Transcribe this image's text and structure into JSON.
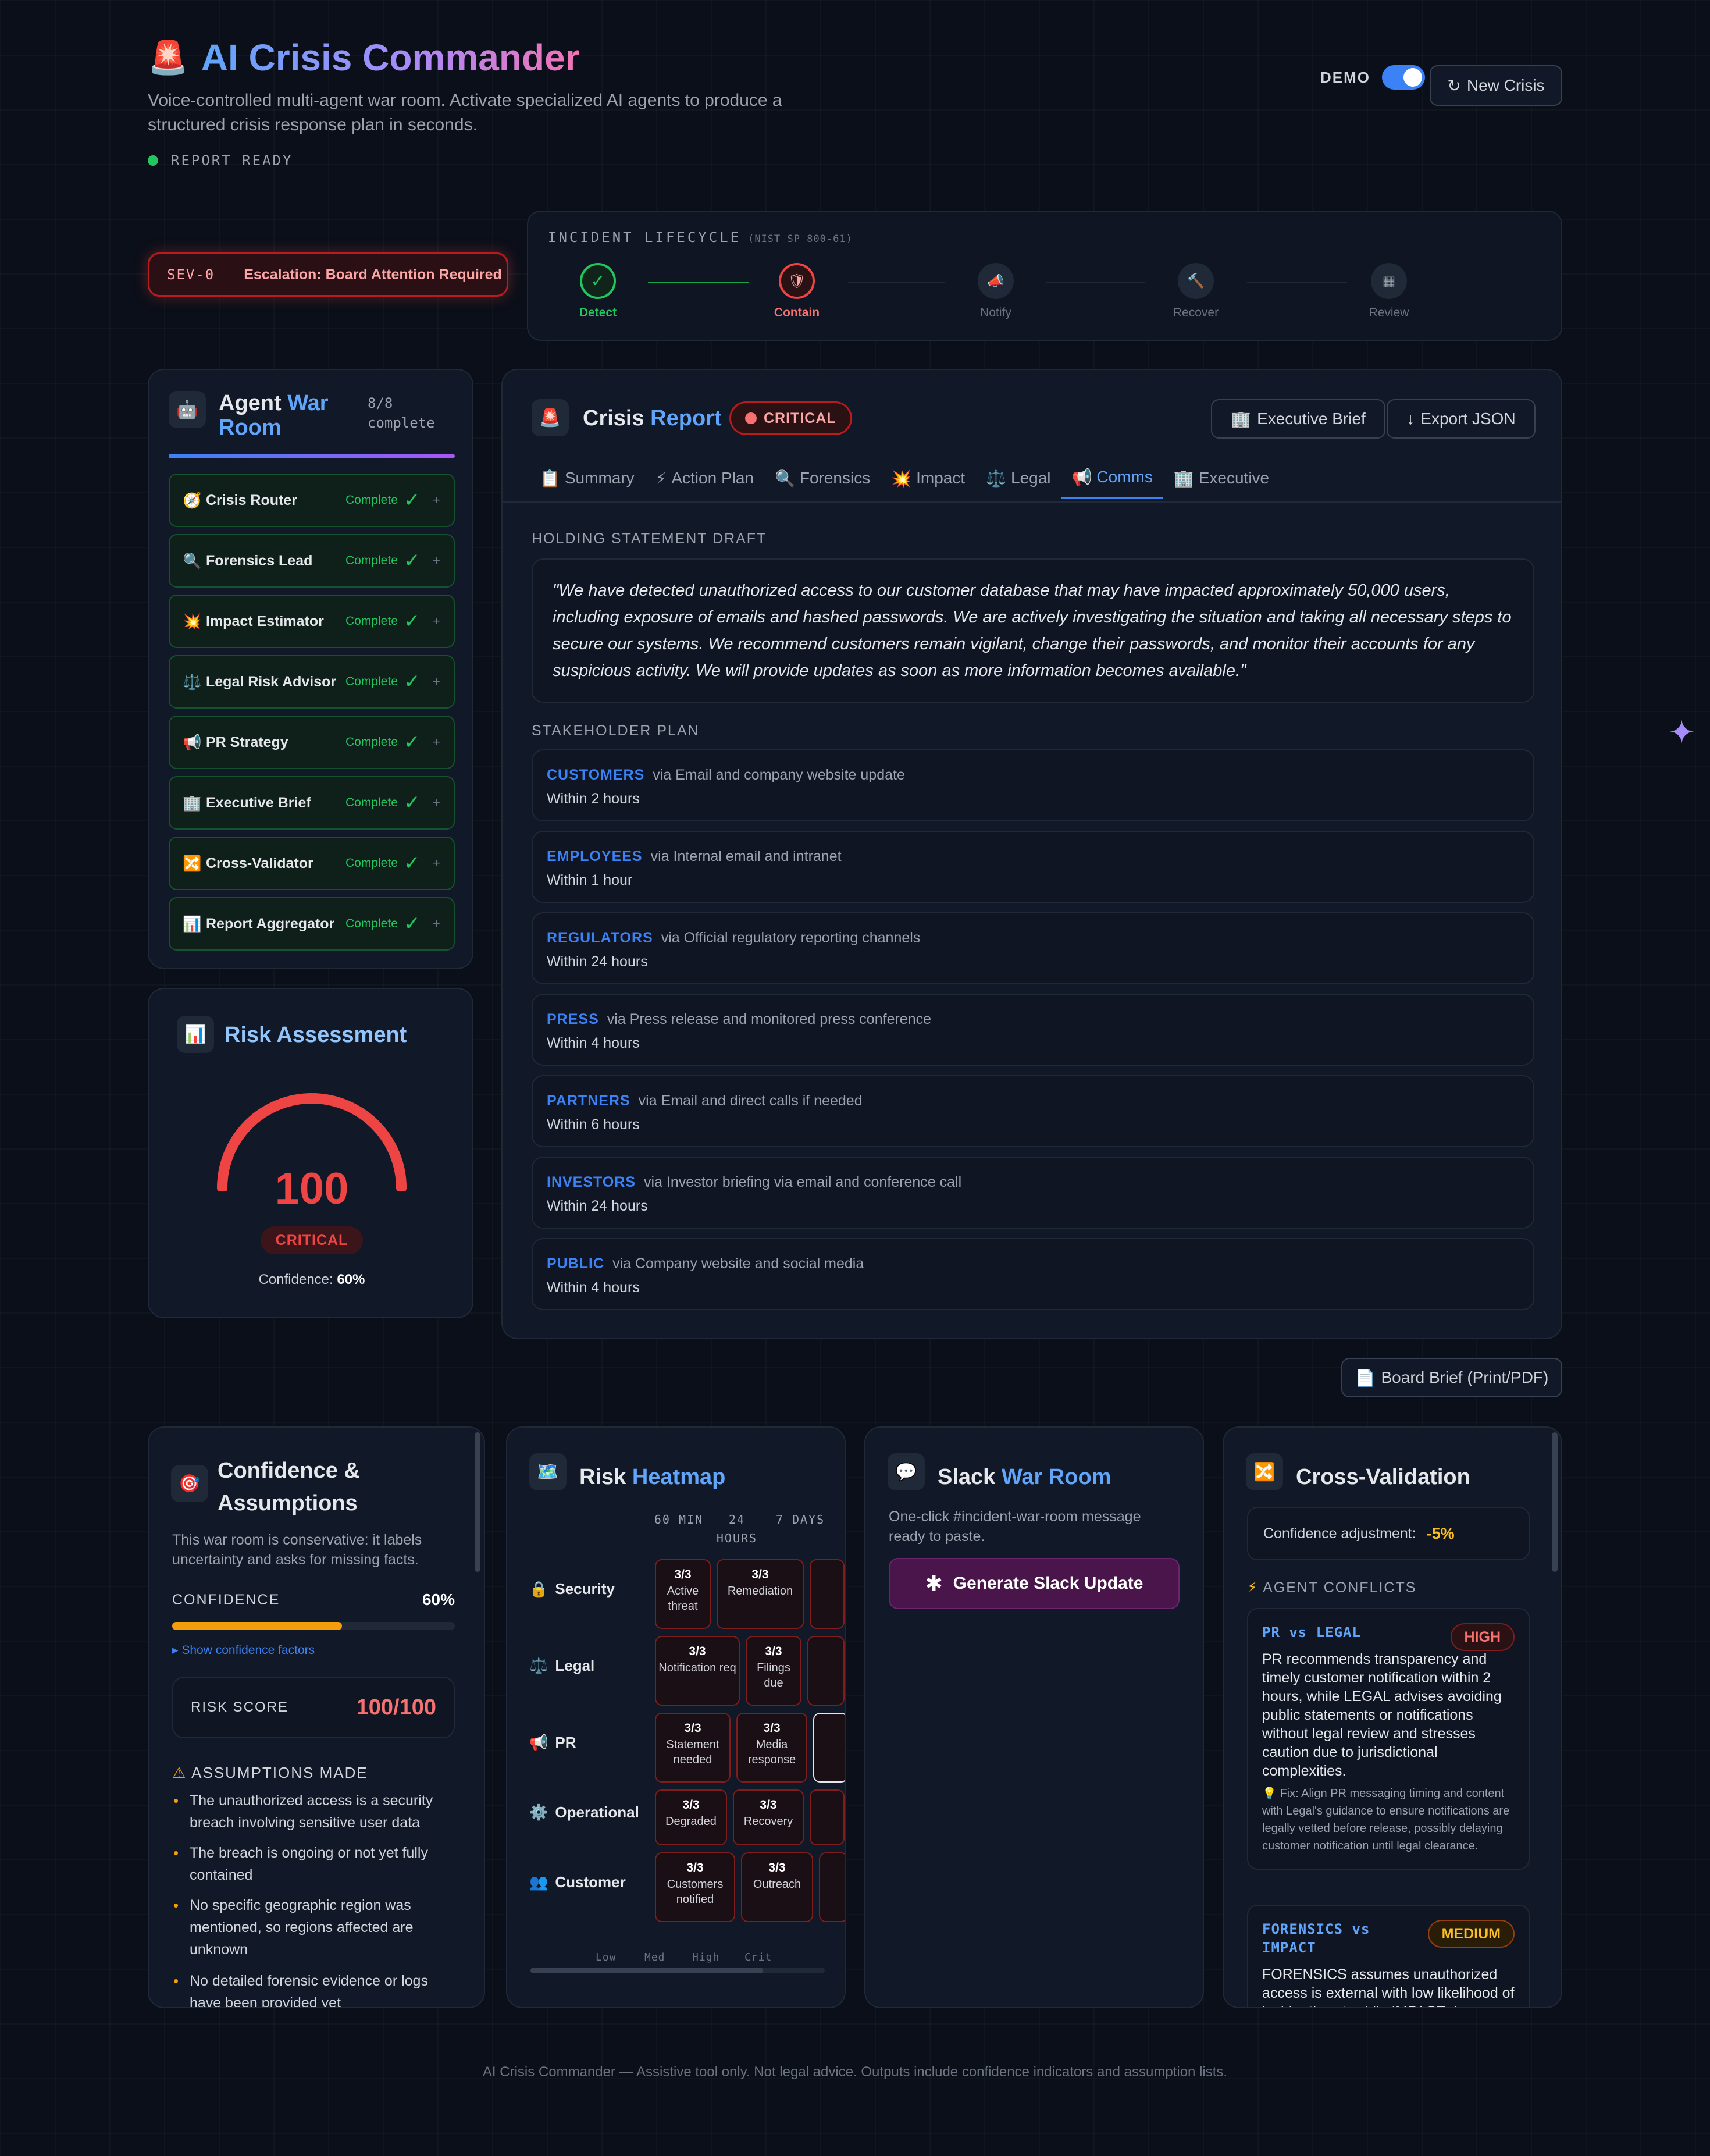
{
  "header": {
    "title": "AI Crisis Commander",
    "subtitle": "Voice-controlled multi-agent war room. Activate specialized AI agents to produce a structured crisis response plan in seconds.",
    "status": "REPORT READY",
    "demo_label": "DEMO",
    "demo_on": true,
    "new_crisis_label": "New Crisis"
  },
  "severity": {
    "code": "SEV-0",
    "message": "Escalation: Board Attention Required"
  },
  "lifecycle": {
    "title": "INCIDENT LIFECYCLE",
    "standard": "(NIST SP 800-61)",
    "stages": [
      {
        "name": "Detect",
        "state": "done",
        "glyph": "✓"
      },
      {
        "name": "Contain",
        "state": "active",
        "glyph": "🛡"
      },
      {
        "name": "Notify",
        "state": "pending",
        "glyph": "📣"
      },
      {
        "name": "Recover",
        "state": "pending",
        "glyph": "🔨"
      },
      {
        "name": "Review",
        "state": "pending",
        "glyph": "▦"
      }
    ]
  },
  "war_room": {
    "title_a": "Agent ",
    "title_b": "War Room",
    "count": "8/8",
    "count_label": "complete",
    "agents": [
      {
        "icon": "🧭",
        "name": "Crisis Router",
        "status": "Complete"
      },
      {
        "icon": "🔍",
        "name": "Forensics Lead",
        "status": "Complete"
      },
      {
        "icon": "💥",
        "name": "Impact Estimator",
        "status": "Complete"
      },
      {
        "icon": "⚖️",
        "name": "Legal Risk Advisor",
        "status": "Complete"
      },
      {
        "icon": "📢",
        "name": "PR Strategy",
        "status": "Complete"
      },
      {
        "icon": "🏢",
        "name": "Executive Brief",
        "status": "Complete"
      },
      {
        "icon": "🔀",
        "name": "Cross-Validator",
        "status": "Complete"
      },
      {
        "icon": "📊",
        "name": "Report Aggregator",
        "status": "Complete"
      }
    ]
  },
  "risk": {
    "title": "Risk Assessment",
    "score": 100,
    "score_max": 100,
    "level": "CRITICAL",
    "confidence_label": "Confidence:",
    "confidence": "60%"
  },
  "report": {
    "title_a": "Crisis ",
    "title_b": "Report",
    "badge": "CRITICAL",
    "exec_brief_label": "Executive Brief",
    "export_label": "Export JSON",
    "tabs": [
      {
        "icon": "📋",
        "label": "Summary"
      },
      {
        "icon": "⚡",
        "label": "Action Plan"
      },
      {
        "icon": "🔍",
        "label": "Forensics"
      },
      {
        "icon": "💥",
        "label": "Impact"
      },
      {
        "icon": "⚖️",
        "label": "Legal"
      },
      {
        "icon": "📢",
        "label": "Comms",
        "active": true
      },
      {
        "icon": "🏢",
        "label": "Executive"
      }
    ],
    "holding_label": "HOLDING STATEMENT DRAFT",
    "holding_statement": "\"We have detected unauthorized access to our customer database that may have impacted approximately 50,000 users, including exposure of emails and hashed passwords. We are actively investigating the situation and taking all necessary steps to secure our systems. We recommend customers remain vigilant, change their passwords, and monitor their accounts for any suspicious activity. We will provide updates as soon as more information becomes available.\"",
    "stakeholder_label": "STAKEHOLDER PLAN",
    "stakeholders": [
      {
        "who": "CUSTOMERS",
        "via": "via Email and company website update",
        "when": "Within 2 hours"
      },
      {
        "who": "EMPLOYEES",
        "via": "via Internal email and intranet",
        "when": "Within 1 hour"
      },
      {
        "who": "REGULATORS",
        "via": "via Official regulatory reporting channels",
        "when": "Within 24 hours"
      },
      {
        "who": "PRESS",
        "via": "via Press release and monitored press conference",
        "when": "Within 4 hours"
      },
      {
        "who": "PARTNERS",
        "via": "via Email and direct calls if needed",
        "when": "Within 6 hours"
      },
      {
        "who": "INVESTORS",
        "via": "via Investor briefing via email and conference call",
        "when": "Within 24 hours"
      },
      {
        "who": "PUBLIC",
        "via": "via Company website and social media",
        "when": "Within 4 hours"
      }
    ]
  },
  "board_brief_label": "Board Brief (Print/PDF)",
  "confidence_panel": {
    "title": "Confidence & Assumptions",
    "intro": "This war room is conservative: it labels uncertainty and asks for missing facts.",
    "confidence_label": "CONFIDENCE",
    "confidence_value": "60%",
    "confidence_fraction": 0.6,
    "factors_link": "▸ Show confidence factors",
    "risk_score_label": "RISK SCORE",
    "risk_score_value": "100/100",
    "assumptions_label": "ASSUMPTIONS MADE",
    "assumptions": [
      "The unauthorized access is a security breach involving sensitive user data",
      "The breach is ongoing or not yet fully contained",
      "No specific geographic region was mentioned, so regions affected are unknown",
      "No detailed forensic evidence or logs have been provided yet"
    ]
  },
  "heatmap": {
    "title_a": "Risk ",
    "title_b": "Heatmap",
    "columns": [
      "60 MIN",
      "24 HOURS",
      "7 DAYS"
    ],
    "rows": [
      {
        "icon": "🔒",
        "label": "Security",
        "cells": [
          {
            "v": "3/3",
            "t": "Active threat"
          },
          {
            "v": "3/3",
            "t": "Remediation"
          }
        ]
      },
      {
        "icon": "⚖️",
        "label": "Legal",
        "cells": [
          {
            "v": "3/3",
            "t": "Notification req"
          },
          {
            "v": "3/3",
            "t": "Filings due"
          }
        ]
      },
      {
        "icon": "📢",
        "label": "PR",
        "cells": [
          {
            "v": "3/3",
            "t": "Statement needed"
          },
          {
            "v": "3/3",
            "t": "Media response"
          }
        ]
      },
      {
        "icon": "⚙️",
        "label": "Operational",
        "cells": [
          {
            "v": "3/3",
            "t": "Degraded"
          },
          {
            "v": "3/3",
            "t": "Recovery"
          }
        ]
      },
      {
        "icon": "👥",
        "label": "Customer",
        "cells": [
          {
            "v": "3/3",
            "t": "Customers notified"
          },
          {
            "v": "3/3",
            "t": "Outreach"
          }
        ]
      }
    ],
    "legend": [
      "Low",
      "Med",
      "High",
      "Crit"
    ]
  },
  "slack": {
    "title_a": "Slack ",
    "title_b": "War Room",
    "desc": "One-click #incident-war-room message ready to paste.",
    "button": "Generate Slack Update"
  },
  "cross_validation": {
    "title": "Cross-Validation",
    "adjust_label": "Confidence adjustment:",
    "adjust_value": "-5%",
    "conflicts_label": "AGENT CONFLICTS",
    "conflicts": [
      {
        "pair": "PR vs LEGAL",
        "level": "HIGH",
        "text": "PR recommends transparency and timely customer notification within 2 hours, while LEGAL advises avoiding public statements or notifications without legal review and stresses caution due to jurisdictional complexities.",
        "fix": "💡 Fix: Align PR messaging timing and content with Legal's guidance to ensure notifications are legally vetted before release, possibly delaying customer notification until legal clearance."
      },
      {
        "pair": "FORENSICS vs IMPACT",
        "level": "MEDIUM",
        "text": "FORENSICS assumes unauthorized access is external with low likelihood of insider threat, while IMPACT does"
      }
    ]
  },
  "footer": "AI Crisis Commander — Assistive tool only. Not legal advice. Outputs include confidence indicators and assumption lists.",
  "colors": {
    "accent": "#3b82f6",
    "critical": "#ef4444",
    "success": "#22c55e",
    "warning": "#f59e0b"
  }
}
